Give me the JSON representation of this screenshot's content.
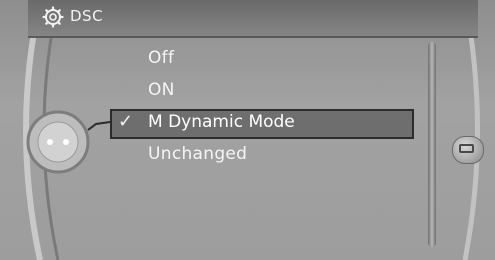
{
  "header": {
    "title": "DSC",
    "icon": "gear-icon"
  },
  "menu": {
    "items": [
      {
        "label": "Off"
      },
      {
        "label": "ON"
      },
      {
        "label": "M Dynamic Mode"
      },
      {
        "label": "Unchanged"
      }
    ],
    "selected_index": 2,
    "check_glyph": "✓"
  },
  "colors": {
    "background": "#9d9d9d",
    "header": "#767676",
    "text": "#f5f5f5",
    "selection_border": "#2b2b2b"
  }
}
